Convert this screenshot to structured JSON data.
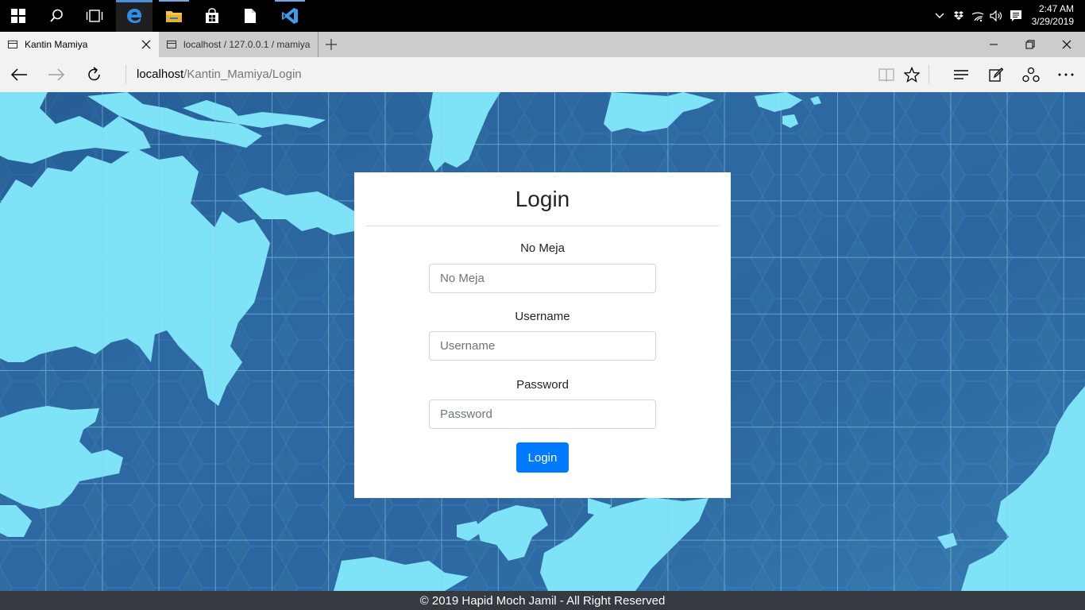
{
  "taskbar": {
    "icons": [
      "windows-start-icon",
      "search-icon",
      "task-view-icon",
      "edge-icon",
      "file-explorer-icon",
      "store-icon",
      "document-icon",
      "vscode-icon"
    ],
    "tray_icons": [
      "chevron-up-icon",
      "dropbox-icon",
      "wifi-icon",
      "volume-icon",
      "notification-icon"
    ],
    "time": "2:47 AM",
    "date": "3/29/2019"
  },
  "browser": {
    "tabs": [
      {
        "title": "Kantin Mamiya",
        "active": true
      },
      {
        "title": "localhost / 127.0.0.1 / mamiya",
        "active": false
      }
    ],
    "url_host": "localhost",
    "url_path": "/Kantin_Mamiya/Login"
  },
  "login": {
    "title": "Login",
    "fields": [
      {
        "label": "No Meja",
        "placeholder": "No Meja",
        "value": ""
      },
      {
        "label": "Username",
        "placeholder": "Username",
        "value": ""
      },
      {
        "label": "Password",
        "placeholder": "Password",
        "value": ""
      }
    ],
    "submit_label": "Login"
  },
  "footer": {
    "text": "© 2019 Hapid Moch Jamil - All Right Reserved"
  },
  "colors": {
    "background": "#2f6ba0",
    "land": "#7fe3f7",
    "grid": "#8fd0ee",
    "button": "#007bff",
    "footer": "#343a40"
  }
}
